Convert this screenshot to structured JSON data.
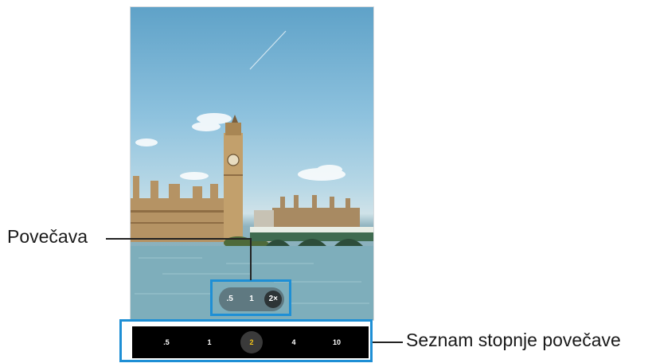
{
  "preview": {
    "zoom_pill": {
      "options": [
        ".5",
        "1",
        "2×"
      ],
      "selected_index": 2
    }
  },
  "zoom_list": {
    "options": [
      ".5",
      "1",
      "2",
      "4",
      "10"
    ],
    "selected_index": 2,
    "selected_color": "#f5c518"
  },
  "callouts": {
    "zoom": "Povečava",
    "zoom_levels": "Seznam stopnje povečave"
  },
  "colors": {
    "highlight": "#1e8fd5"
  }
}
